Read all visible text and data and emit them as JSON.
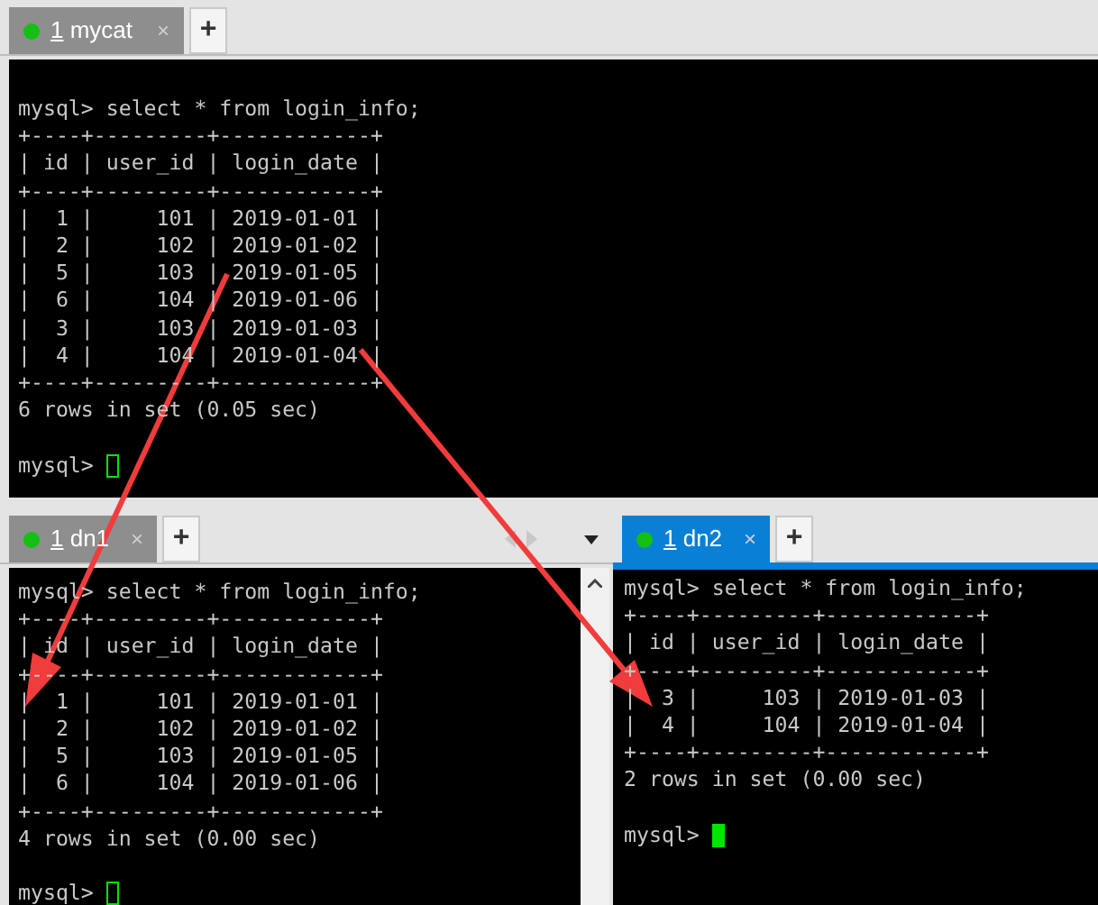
{
  "panes": [
    {
      "tab": {
        "number": "1",
        "label": "mycat",
        "close": "×",
        "selected": false
      },
      "new_tab": "+",
      "prompt": "mysql>",
      "cursor_focused": false,
      "lines": [
        "mysql> select * from login_info;",
        "+----+---------+------------+",
        "| id | user_id | login_date |",
        "+----+---------+------------+",
        "|  1 |     101 | 2019-01-01 |",
        "|  2 |     102 | 2019-01-02 |",
        "|  5 |     103 | 2019-01-05 |",
        "|  6 |     104 | 2019-01-06 |",
        "|  3 |     103 | 2019-01-03 |",
        "|  4 |     104 | 2019-01-04 |",
        "+----+---------+------------+",
        "6 rows in set (0.05 sec)"
      ]
    },
    {
      "tab": {
        "number": "1",
        "label": "dn1",
        "close": "×",
        "selected": false
      },
      "new_tab": "+",
      "prompt": "mysql>",
      "cursor_focused": false,
      "lines": [
        "mysql> select * from login_info;",
        "+----+---------+------------+",
        "| id | user_id | login_date |",
        "+----+---------+------------+",
        "|  1 |     101 | 2019-01-01 |",
        "|  2 |     102 | 2019-01-02 |",
        "|  5 |     103 | 2019-01-05 |",
        "|  6 |     104 | 2019-01-06 |",
        "+----+---------+------------+",
        "4 rows in set (0.00 sec)"
      ]
    },
    {
      "tab": {
        "number": "1",
        "label": "dn2",
        "close": "×",
        "selected": true
      },
      "new_tab": "+",
      "prompt": "mysql>",
      "cursor_focused": true,
      "lines": [
        "mysql> select * from login_info;",
        "+----+---------+------------+",
        "| id | user_id | login_date |",
        "+----+---------+------------+",
        "|  3 |     103 | 2019-01-03 |",
        "|  4 |     104 | 2019-01-04 |",
        "+----+---------+------------+",
        "2 rows in set (0.00 sec)"
      ]
    }
  ]
}
